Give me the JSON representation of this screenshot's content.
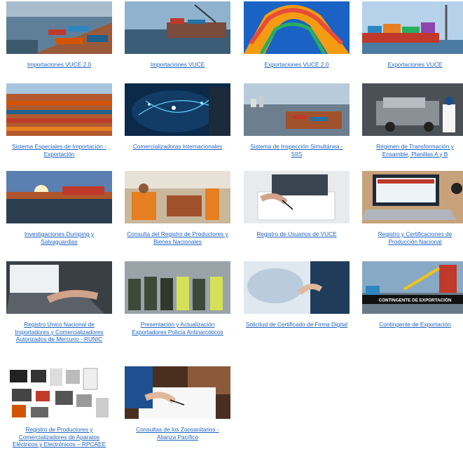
{
  "tiles": [
    {
      "label": "Importaciones VUCE 2.0",
      "image": "port-containers-aerial"
    },
    {
      "label": "Importaciones VUCE",
      "image": "port-ships"
    },
    {
      "label": "Exportaciones VUCE 2.0",
      "image": "containers-arch"
    },
    {
      "label": "Exportaciones VUCE",
      "image": "cargo-ship"
    },
    {
      "label": "Sistema Especiales de Importación - Exportación",
      "image": "container-yard"
    },
    {
      "label": "Comercializadoras Internacionales",
      "image": "global-network"
    },
    {
      "label": "Sistema de Inspección Simultánea - SIIS",
      "image": "port-city"
    },
    {
      "label": "Régimen de Transformación y Ensamble, Planillas A y B",
      "image": "factory-assembly"
    },
    {
      "label": "Investigaciones Dumping y Salvaguardias",
      "image": "sunset-containers"
    },
    {
      "label": "Consulta del Registro de Productores y Bienes Nacionales",
      "image": "workers-inspection"
    },
    {
      "label": "Registro de Usuarios de VUCE",
      "image": "hands-writing"
    },
    {
      "label": "Registro y Certificaciones de Producción Nacional",
      "image": "laptop-typing"
    },
    {
      "label": "Registro Único Nacional de Importadores y Comercializadores Autorizados de Mercurio - RUNIC",
      "image": "laptop-keyboard"
    },
    {
      "label": "Presentación y Actualización Exportadores Policía Antinarcóticos",
      "image": "police-officers"
    },
    {
      "label": "Solicitud de Certificado de Firma Digital",
      "image": "digital-world-hand"
    },
    {
      "label": "Contingente de Exportación",
      "image": "crane-containers",
      "overlay": "CONTINGENTE DE EXPORTACIÓN"
    },
    {
      "label": "Registro de Productores y Comercializadores de Aparatos Eléctricos y Electrónicos – RPCAEE",
      "image": "electronics-appliances"
    },
    {
      "label": "Consultas de los Zoosanitarios - Alianza Pacífico",
      "image": "signing-document"
    }
  ]
}
